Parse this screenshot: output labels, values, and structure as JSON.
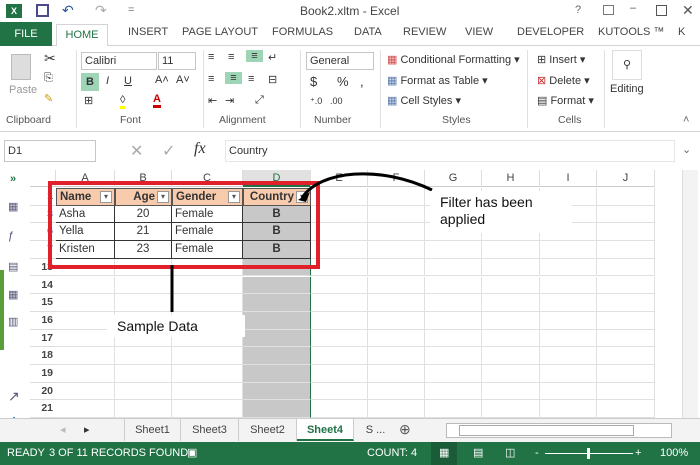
{
  "title": "Book2.xltm - Excel",
  "tabs": [
    "FILE",
    "HOME",
    "INSERT",
    "PAGE LAYOUT",
    "FORMULAS",
    "DATA",
    "REVIEW",
    "VIEW",
    "DEVELOPER",
    "KUTOOLS ™",
    "K"
  ],
  "ribbon": {
    "paste": "Paste",
    "font_name": "Calibri",
    "font_size": "11",
    "bold": "B",
    "italic": "I",
    "underline": "U",
    "number_format": "General",
    "currency": "$",
    "percent": "%",
    "comma": ",",
    "cond_format": "Conditional Formatting",
    "format_table": "Format as Table",
    "cell_styles": "Cell Styles",
    "insert": "Insert",
    "delete": "Delete",
    "format": "Format",
    "editing": "Editing",
    "groups": [
      "Clipboard",
      "Font",
      "Alignment",
      "Number",
      "Styles",
      "Cells"
    ]
  },
  "formula_bar": {
    "name_box": "D1",
    "fx": "fx",
    "value": "Country"
  },
  "columns": [
    "A",
    "B",
    "C",
    "D",
    "E",
    "F",
    "G",
    "H",
    "I",
    "J"
  ],
  "rows": [
    "1",
    "3",
    "6",
    "7",
    "13",
    "14",
    "15",
    "16",
    "17",
    "18",
    "19",
    "20",
    "21"
  ],
  "table": {
    "headers": [
      "Name",
      "Age",
      "Gender",
      "Country"
    ],
    "data": [
      [
        "Asha",
        "20",
        "Female",
        "B"
      ],
      [
        "Yella",
        "21",
        "Female",
        "B"
      ],
      [
        "Kristen",
        "23",
        "Female",
        "B"
      ]
    ]
  },
  "annotations": {
    "filter": "Filter has been applied",
    "sample": "Sample Data"
  },
  "sheets": [
    "Sheet1",
    "Sheet3",
    "Sheet2",
    "Sheet4",
    "S ..."
  ],
  "active_sheet": "Sheet4",
  "status": {
    "ready": "READY",
    "records": "3 OF 11 RECORDS FOUND",
    "count": "COUNT: 4",
    "zoom": "100%"
  },
  "colors": {
    "excel_green": "#217346",
    "header_fill": "#f8cbad",
    "selected_col": "#c8c8c8",
    "annotation_red": "#e0202a"
  }
}
